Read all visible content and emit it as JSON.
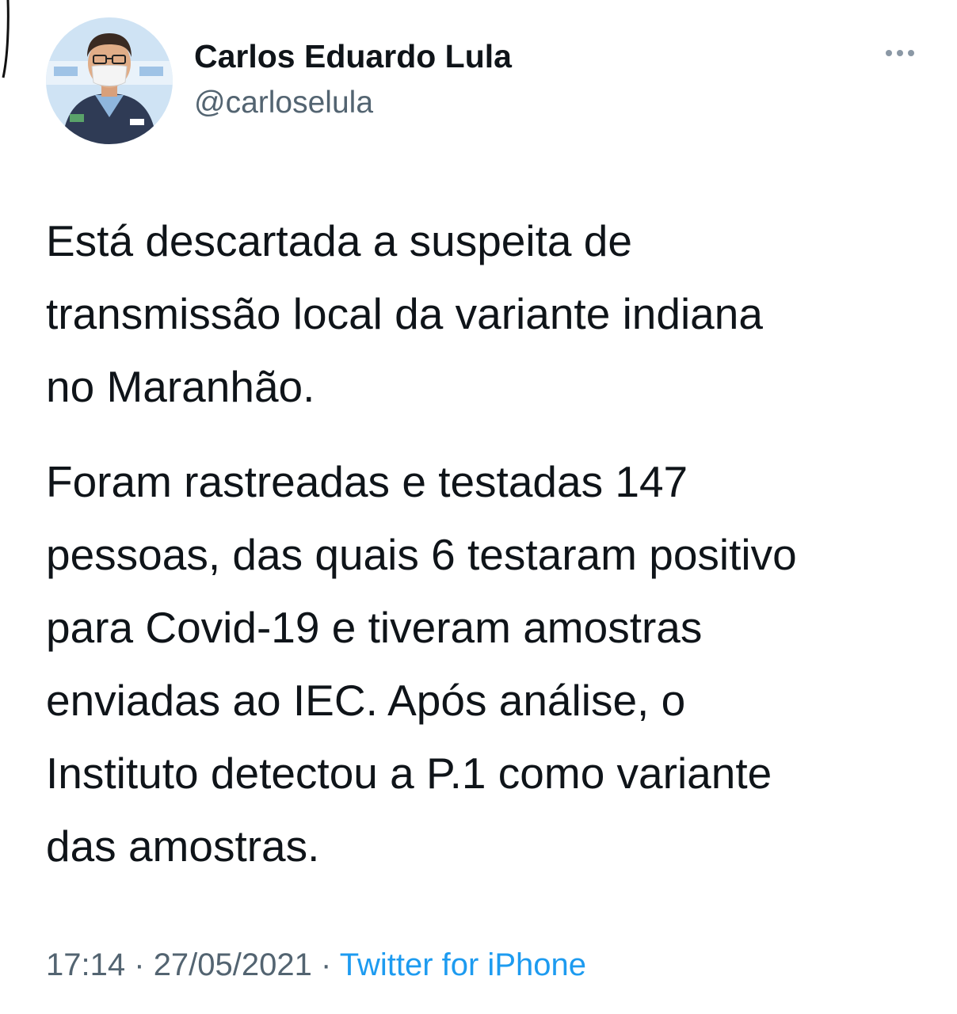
{
  "tweet": {
    "author_name": "Carlos Eduardo Lula",
    "author_handle": "@carloselula",
    "more_icon": "more-horizontal-icon",
    "paragraph1_lines": [
      "Está descartada a suspeita de",
      "transmissão local da variante indiana",
      "no Maranhão."
    ],
    "paragraph2_lines": [
      "Foram rastreadas e testadas 147",
      "pessoas, das quais 6 testaram positivo",
      "para Covid-19 e tiveram amostras",
      "enviadas ao IEC. Após análise, o",
      "Instituto detectou a P.1 como variante",
      "das amostras."
    ],
    "time": "17:14",
    "separator": "·",
    "date": "27/05/2021",
    "source": "Twitter for iPhone"
  },
  "colors": {
    "text": "#0f1419",
    "secondary": "#536471",
    "link": "#1d9bf0"
  }
}
